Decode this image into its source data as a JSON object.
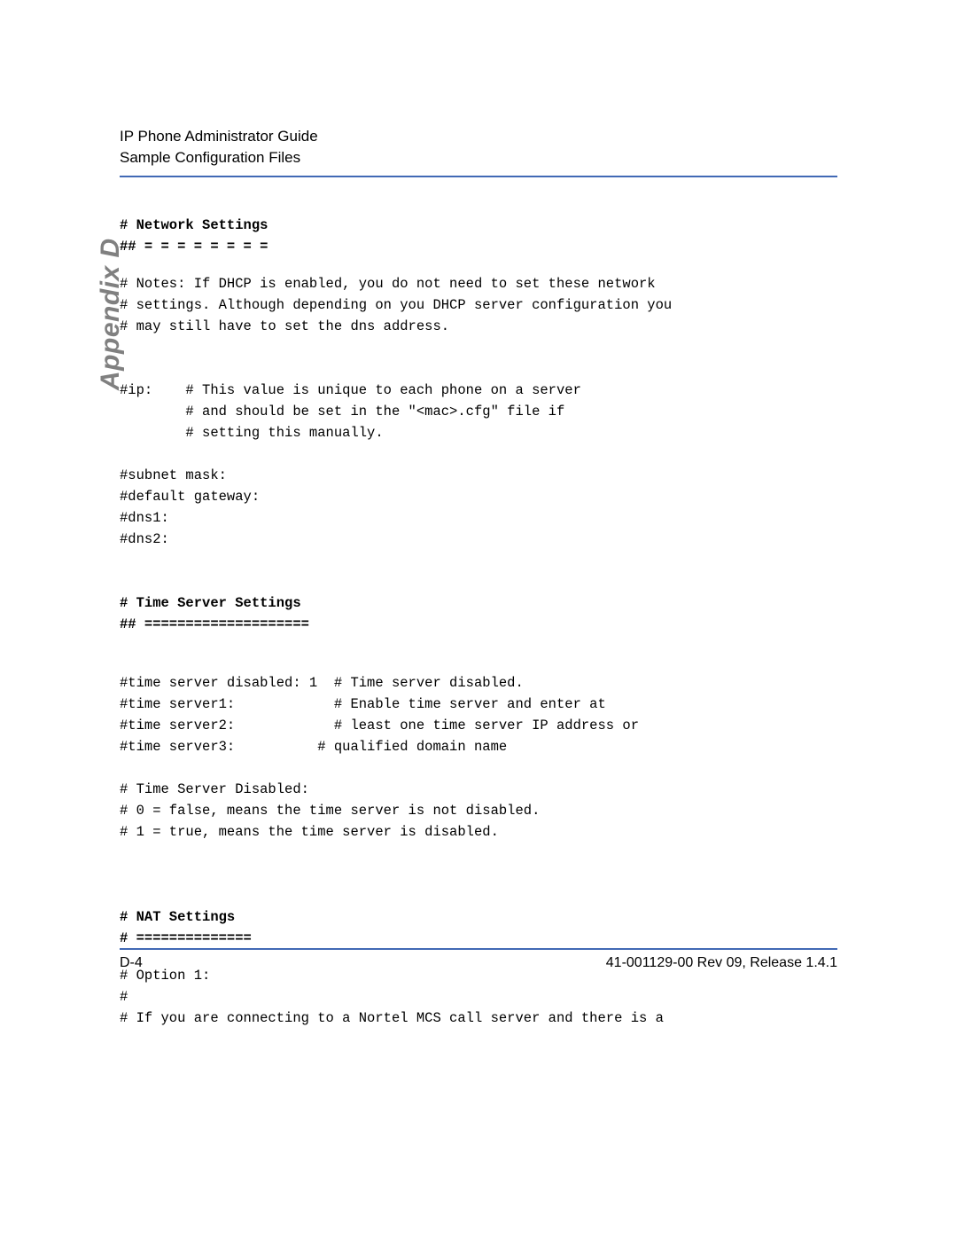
{
  "header": {
    "title": "IP Phone Administrator Guide",
    "subtitle": "Sample Configuration Files"
  },
  "side_tab": "Appendix D",
  "content": {
    "network": {
      "heading": "# Network Settings",
      "rule": "## = = = = = = = =",
      "note1": "# Notes: If DHCP is enabled, you do not need to set these network",
      "note2": "# settings.  Although depending on you DHCP server configuration you",
      "note3": "# may still have to set the dns address.",
      "ip1": "#ip:    # This value is unique to each phone on a server",
      "ip2": "        # and should be set in the \"<mac>.cfg\" file if",
      "ip3": "        # setting this manually.",
      "subnet": "#subnet mask:",
      "gateway": "#default gateway:",
      "dns1": "#dns1:",
      "dns2": "#dns2:"
    },
    "time": {
      "heading": "# Time Server Settings",
      "rule": "## ====================",
      "line1": "#time server disabled: 1  # Time server disabled.",
      "line2": "#time server1:            # Enable time server and enter at",
      "line3": "#time server2:            # least one time server IP address or",
      "line4": "#time server3:          # qualified domain name",
      "disabled_heading": "# Time Server Disabled:",
      "opt0": "#   0 = false, means the time server is not disabled.",
      "opt1": "#   1 = true, means the time server is disabled."
    },
    "nat": {
      "heading": "# NAT Settings",
      "rule": "# ==============",
      "option": "# Option 1:",
      "blank": "#",
      "note": "#  If you are connecting to a Nortel MCS call server and there is a"
    }
  },
  "footer": {
    "page_num": "D-4",
    "release": "41-001129-00 Rev 09, Release 1.4.1"
  }
}
